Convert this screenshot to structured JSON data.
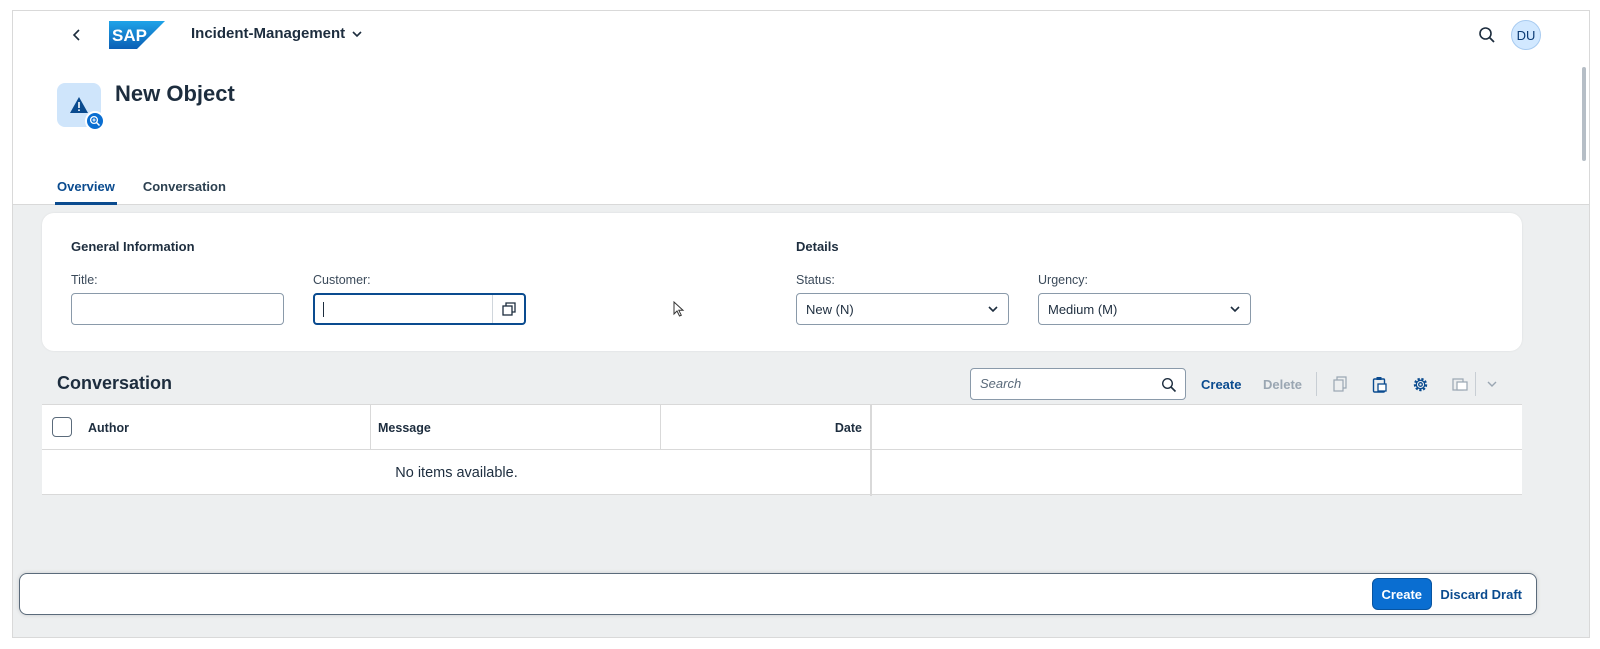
{
  "shell": {
    "app_title": "Incident-Management",
    "avatar_initials": "DU",
    "logo_text": "SAP"
  },
  "header": {
    "title": "New Object",
    "tabs": [
      {
        "label": "Overview",
        "active": true
      },
      {
        "label": "Conversation",
        "active": false
      }
    ]
  },
  "form": {
    "general_title": "General Information",
    "details_title": "Details",
    "title_label": "Title:",
    "title_value": "",
    "customer_label": "Customer:",
    "customer_value": "",
    "status_label": "Status:",
    "status_value": "New (N)",
    "urgency_label": "Urgency:",
    "urgency_value": "Medium (M)"
  },
  "conversation": {
    "title": "Conversation",
    "search_placeholder": "Search",
    "create_label": "Create",
    "delete_label": "Delete",
    "columns": [
      "Author",
      "Message",
      "Date"
    ],
    "no_items": "No items available."
  },
  "footer": {
    "create_label": "Create",
    "discard_label": "Discard Draft"
  },
  "colors": {
    "brand": "#0a6ed1",
    "link": "#0a4b8f",
    "background": "#edeff0"
  },
  "icons": [
    "back-icon",
    "sap-logo",
    "chevron-down-icon",
    "search-icon",
    "warning-icon",
    "zoom-badge-icon",
    "value-help-icon",
    "copy-icon",
    "paste-icon",
    "settings-icon",
    "export-icon"
  ]
}
